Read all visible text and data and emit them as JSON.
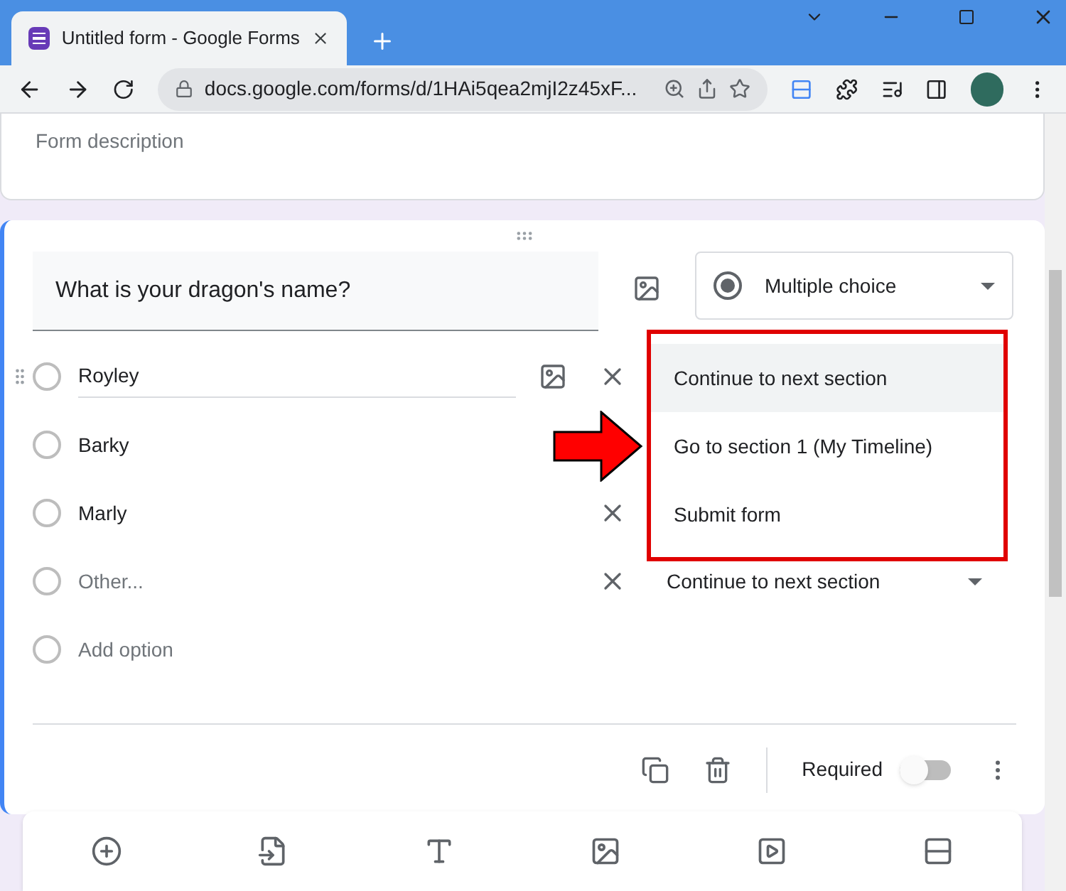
{
  "browser": {
    "tab_title": "Untitled form - Google Forms",
    "url": "docs.google.com/forms/d/1HAi5qea2mjI2z45xF..."
  },
  "form": {
    "description_placeholder": "Form description"
  },
  "question": {
    "title": "What is your dragon's name?",
    "type": "Multiple choice",
    "options": [
      {
        "kind": "option",
        "label": "Royley",
        "focused": true
      },
      {
        "kind": "option",
        "label": "Barky",
        "focused": false
      },
      {
        "kind": "option",
        "label": "Marly",
        "focused": false
      },
      {
        "kind": "other",
        "label": "Other...",
        "focused": false,
        "destination": "Continue to next section"
      },
      {
        "kind": "add",
        "label": "Add option",
        "focused": false
      }
    ],
    "required_label": "Required",
    "required": false
  },
  "section_menu": {
    "items": [
      {
        "label": "Continue to next section",
        "selected": true
      },
      {
        "label": "Go to section 1 (My Timeline)",
        "selected": false
      },
      {
        "label": "Submit form",
        "selected": false
      }
    ]
  }
}
